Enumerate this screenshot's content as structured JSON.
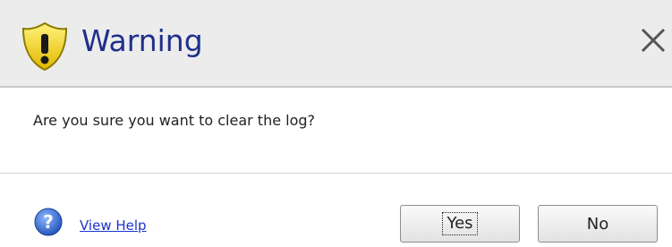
{
  "dialog": {
    "title": "Warning",
    "message": "Are you sure you want to clear the log?",
    "help_link": "View Help",
    "buttons": {
      "yes": "Yes",
      "no": "No"
    },
    "icons": {
      "title": "warning-shield-icon",
      "close": "close-icon",
      "help": "help-icon"
    },
    "colors": {
      "title_text": "#1f2f8a",
      "link": "#1a34c9",
      "shield_yellow": "#f2d31b",
      "help_blue": "#2b63d6"
    }
  }
}
